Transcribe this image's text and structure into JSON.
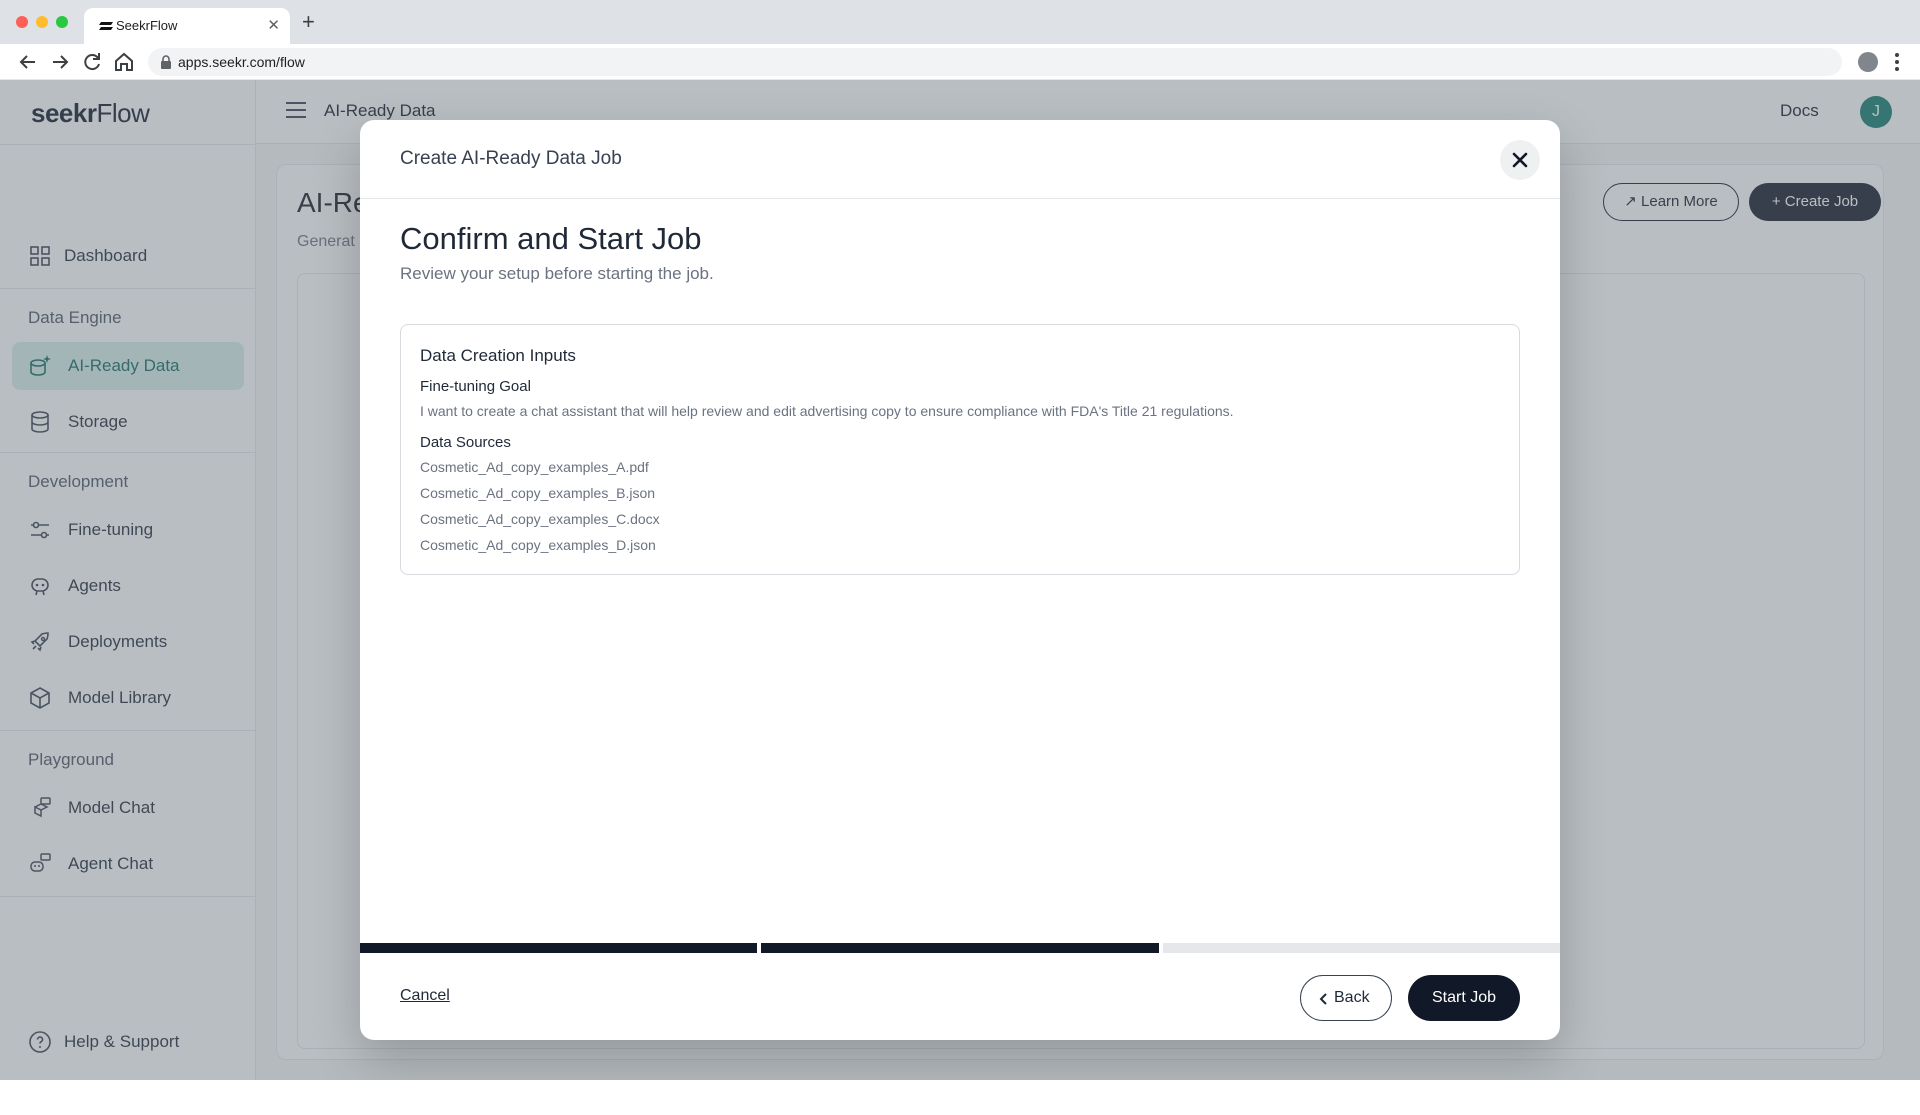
{
  "browser": {
    "tab_title": "SeekrFlow",
    "url": "apps.seekr.com/flow"
  },
  "app": {
    "brand": {
      "bold": "seekr",
      "light": "Flow"
    },
    "sidebar": {
      "items": [
        {
          "label": "Dashboard",
          "icon": "dashboard-grid-icon"
        },
        {
          "label": "AI-Ready Data",
          "icon": "database-sparkle-icon",
          "active": true
        },
        {
          "label": "Storage",
          "icon": "database-icon"
        },
        {
          "label": "Fine-tuning",
          "icon": "sliders-icon"
        },
        {
          "label": "Agents",
          "icon": "agent-icon"
        },
        {
          "label": "Deployments",
          "icon": "rocket-icon"
        },
        {
          "label": "Model Library",
          "icon": "cube-icon"
        },
        {
          "label": "Model Chat",
          "icon": "model-chat-icon"
        },
        {
          "label": "Agent Chat",
          "icon": "agent-chat-icon"
        }
      ],
      "sections": [
        "Data Engine",
        "Development",
        "Playground"
      ],
      "help": "Help & Support"
    },
    "topbar": {
      "title": "AI-Ready Data",
      "docs": "Docs",
      "avatar": "J"
    },
    "page": {
      "title": "AI-Re",
      "subtitle": "Generat",
      "learn_more": "Learn More",
      "create_job": "+ Create Job"
    }
  },
  "modal": {
    "header_title": "Create AI-Ready Data Job",
    "step_title": "Confirm and Start Job",
    "step_subtitle": "Review your setup before starting the job.",
    "summary": {
      "title": "Data Creation Inputs",
      "goal_label": "Fine-tuning Goal",
      "goal_value": "I want to create a chat assistant that will help review and edit advertising copy to ensure compliance with FDA's Title 21 regulations.",
      "sources_label": "Data Sources",
      "sources": [
        "Cosmetic_Ad_copy_examples_A.pdf",
        "Cosmetic_Ad_copy_examples_B.json",
        "Cosmetic_Ad_copy_examples_C.docx",
        "Cosmetic_Ad_copy_examples_D.json"
      ]
    },
    "progress": {
      "steps_total": 3,
      "steps_completed": 2
    },
    "footer": {
      "cancel": "Cancel",
      "back": "Back",
      "start": "Start Job"
    }
  },
  "colors": {
    "accent_dark": "#111827",
    "active_nav_bg": "#d9efec",
    "active_nav_text": "#0e6b61",
    "progress_pending": "#e5e7eb"
  }
}
